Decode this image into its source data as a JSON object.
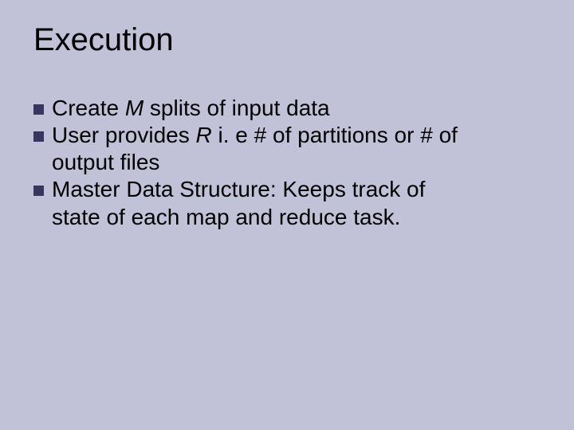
{
  "title": "Execution",
  "bullets": [
    {
      "parts": [
        {
          "t": "Create ",
          "i": false
        },
        {
          "t": "M",
          "i": true
        },
        {
          "t": " splits of input data",
          "i": false
        }
      ]
    },
    {
      "parts": [
        {
          "t": "User provides ",
          "i": false
        },
        {
          "t": "R",
          "i": true
        },
        {
          "t": " i. e # of partitions or # of",
          "i": false
        }
      ],
      "cont": [
        {
          "t": "output files",
          "i": false
        }
      ]
    },
    {
      "parts": [
        {
          "t": "Master Data Structure: Keeps track of",
          "i": false
        }
      ],
      "cont": [
        {
          "t": "state of each map and reduce task.",
          "i": false
        }
      ]
    }
  ]
}
